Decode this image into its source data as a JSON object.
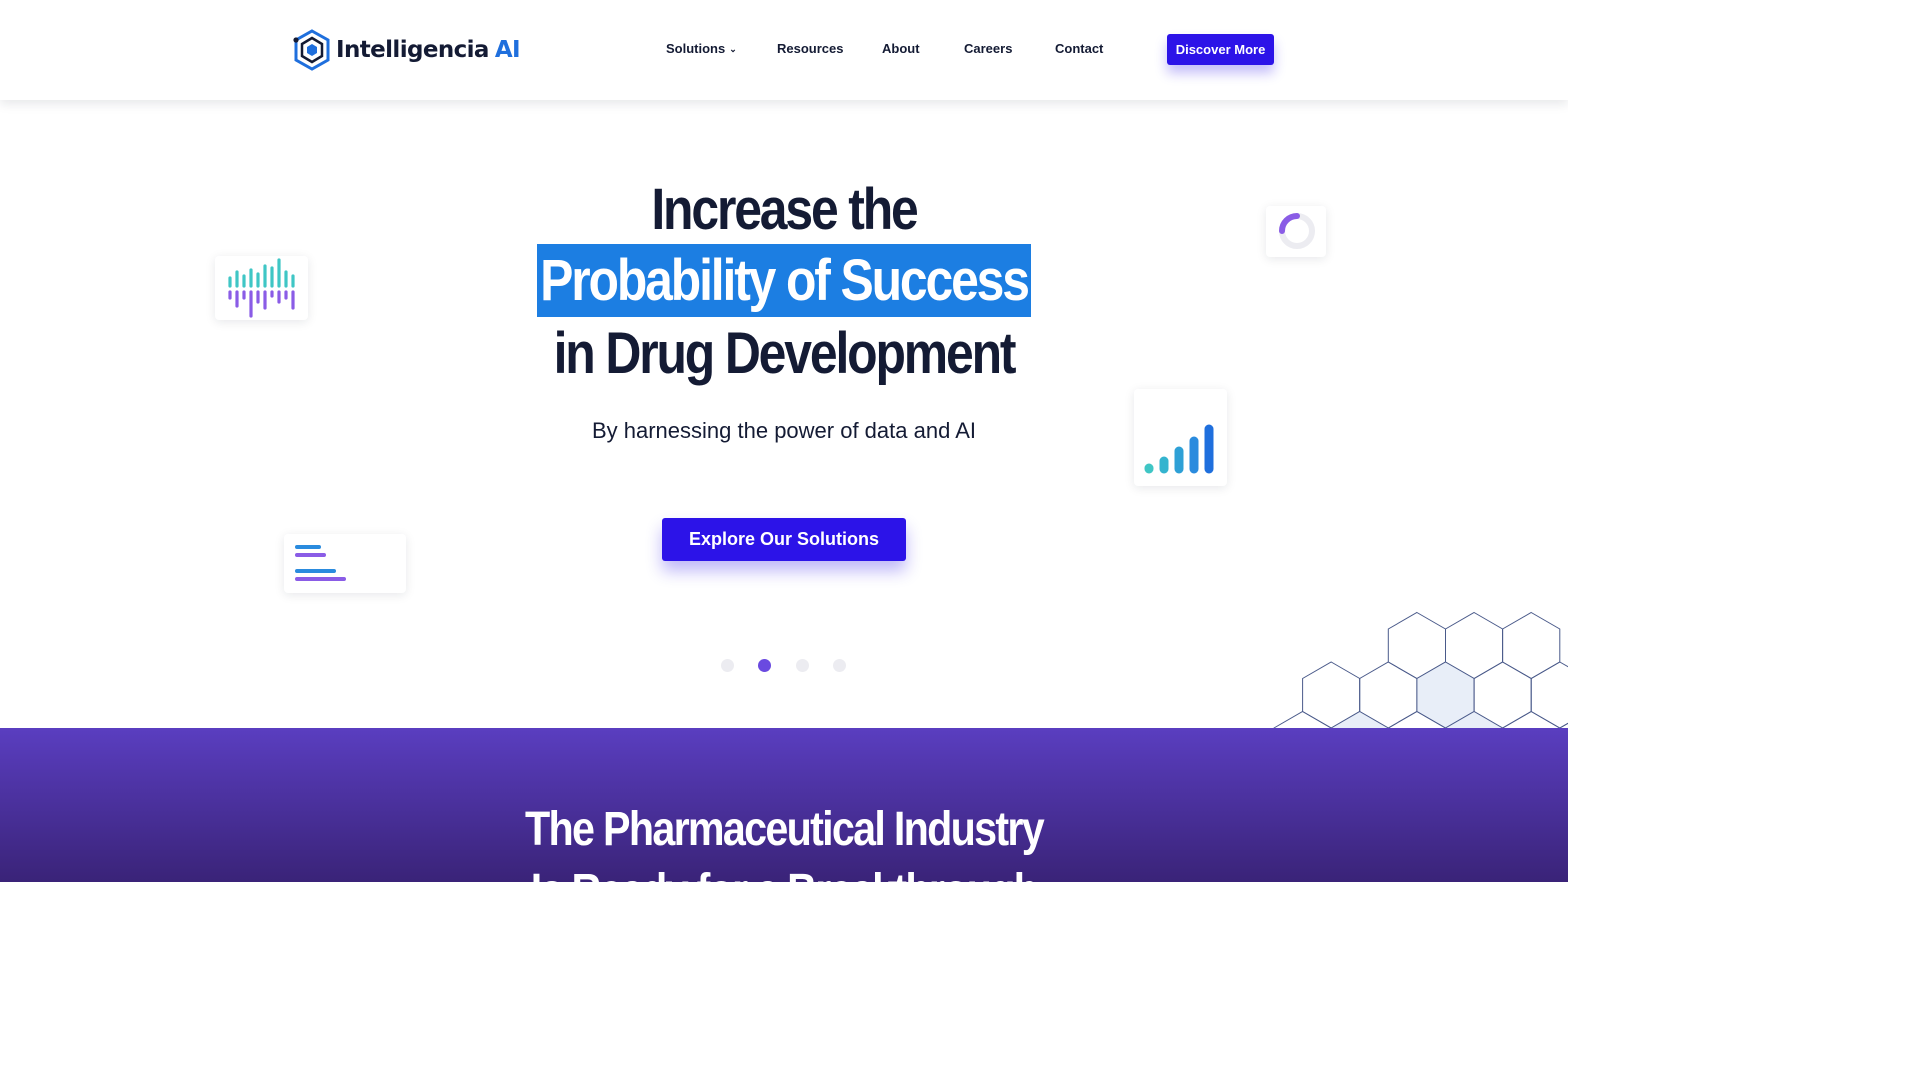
{
  "header": {
    "logo": {
      "brand": "Intelligencia",
      "suffix": "AI",
      "icon": "hexagon-logo-icon"
    },
    "nav": [
      {
        "label": "Solutions",
        "has_dropdown": true
      },
      {
        "label": "Resources"
      },
      {
        "label": "About"
      },
      {
        "label": "Careers"
      },
      {
        "label": "Contact"
      }
    ],
    "cta_label": "Discover More"
  },
  "hero": {
    "title_line1": "Increase the",
    "title_highlight": "Probability of Success",
    "title_line3": "in Drug Development",
    "subtitle": "By harnessing the power of data and AI",
    "cta_label": "Explore Our Solutions",
    "carousel": {
      "slides": 4,
      "active_index": 1
    },
    "decor_icons": [
      "waveform-bars-icon",
      "loading-ring-icon",
      "signal-bars-icon",
      "horizontal-bars-icon",
      "hexagon-pattern"
    ]
  },
  "section2": {
    "title_line1": "The Pharmaceutical Industry",
    "title_line2": "Is Ready for a Breakthrough"
  },
  "colors": {
    "navy": "#141b34",
    "primary_button": "#2c13e8",
    "highlight_blue": "#1c7ee2",
    "purple_band": "#4a2f9c",
    "teal": "#3fc6c5",
    "violet": "#7f57e0"
  }
}
